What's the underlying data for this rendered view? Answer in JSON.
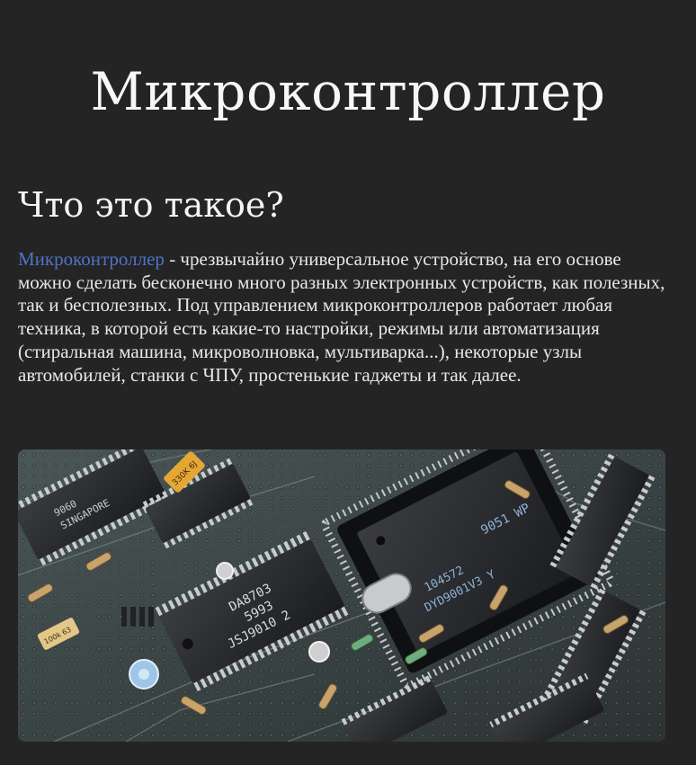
{
  "page": {
    "title": "Микроконтроллер"
  },
  "section": {
    "heading": "Что это такое?",
    "link_text": "Микроконтроллер",
    "body_text": " - чрезвычайно универсальное устройство, на его основе можно сделать бесконечно много разных электронных устройств, как полезных, так и бесполезных. Под управлением микроконтроллеров работает любая техника, в которой есть какие-то настройки, режимы или автоматизация (стиральная машина, микроволновка, мультиварка...), некоторые узлы автомобилей, станки с ЧПУ, простенькие гаджеты и так далее."
  },
  "hero_image": {
    "chip_labels": {
      "main_line1": "9051 WP",
      "main_line2": "104572",
      "main_line3": "DYD9001V3 Y",
      "dip1_line1": "DA8703",
      "dip1_line2": "5993",
      "dip1_line3": "JSJ9010 2",
      "dip2_line1": "9060",
      "dip2_line2": "SINGAPORE",
      "cap_label": "330K 6J",
      "left_tag": "100k 63"
    }
  }
}
